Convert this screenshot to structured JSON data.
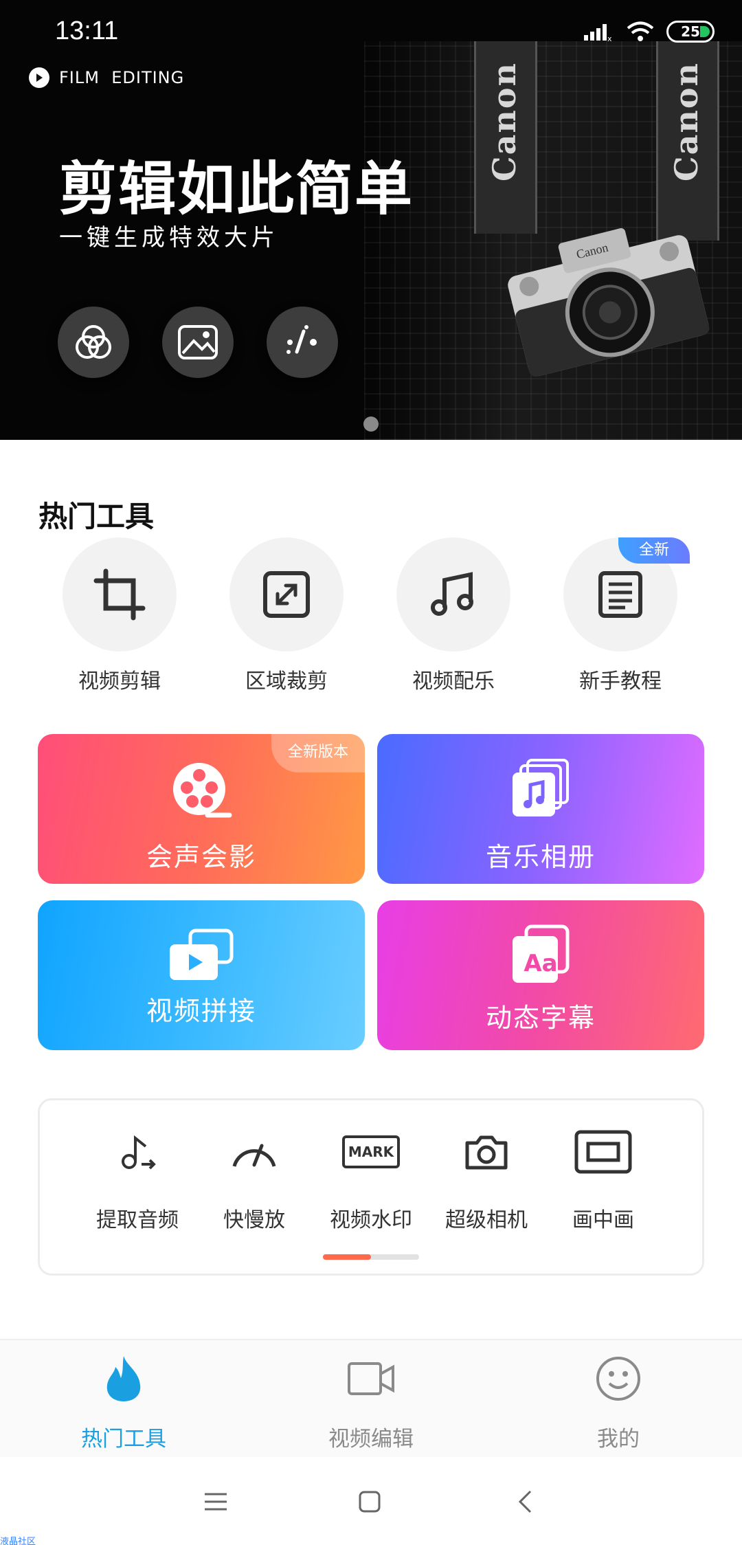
{
  "status_bar": {
    "time": "13:11",
    "battery": "25"
  },
  "hero": {
    "brand": "FILM  EDITING",
    "title": "剪辑如此简单",
    "subtitle": "一键生成特效大片",
    "strap_text": "Canon",
    "buttons": [
      "filter-icon",
      "image-icon",
      "magic-wand-icon"
    ]
  },
  "hot_tools": {
    "title": "热门工具",
    "items": [
      {
        "label": "视频剪辑",
        "icon": "crop-icon"
      },
      {
        "label": "区域裁剪",
        "icon": "resize-icon"
      },
      {
        "label": "视频配乐",
        "icon": "music-note-icon"
      },
      {
        "label": "新手教程",
        "icon": "document-icon"
      }
    ],
    "new_badge": "全新"
  },
  "cards": [
    {
      "label": "会声会影",
      "badge": "全新版本",
      "icon": "film-reel-icon"
    },
    {
      "label": "音乐相册",
      "icon": "music-album-icon"
    },
    {
      "label": "视频拼接",
      "icon": "video-stack-icon"
    },
    {
      "label": "动态字幕",
      "icon": "subtitle-icon",
      "icon_text": "Aa"
    }
  ],
  "more_tools": [
    {
      "label": "提取音频",
      "icon": "audio-extract-icon"
    },
    {
      "label": "快慢放",
      "icon": "speedometer-icon"
    },
    {
      "label": "视频水印",
      "icon": "watermark-icon",
      "icon_text": "MARK"
    },
    {
      "label": "超级相机",
      "icon": "camera-icon"
    },
    {
      "label": "画中画",
      "icon": "picture-in-picture-icon"
    }
  ],
  "bottom_nav": [
    {
      "label": "热门工具",
      "icon": "flame-icon",
      "active": true
    },
    {
      "label": "视频编辑",
      "icon": "video-camera-icon",
      "active": false
    },
    {
      "label": "我的",
      "icon": "smiley-icon",
      "active": false
    }
  ],
  "watermark": "液晶社区",
  "colors": {
    "accent": "#1a9fe0",
    "scroll_thumb": "#ff6a4c"
  }
}
